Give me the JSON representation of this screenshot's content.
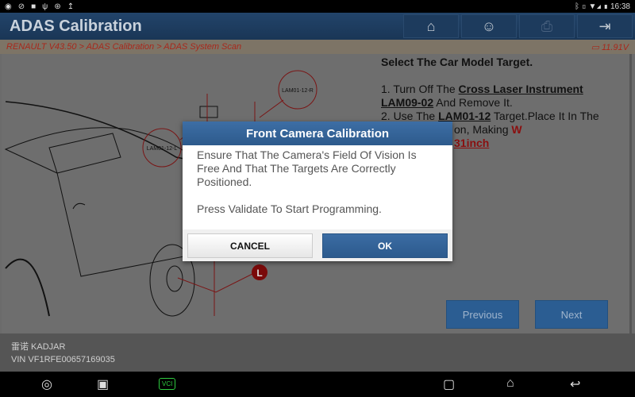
{
  "status_bar": {
    "time": "16:38",
    "left_icons": [
      "whatsapp-icon",
      "compass-icon",
      "image-icon",
      "usb-icon",
      "settings-icon",
      "upload-icon"
    ],
    "right_icons": [
      "bluetooth-icon",
      "vibrate-icon",
      "wifi-icon",
      "signal-icon",
      "battery-icon"
    ]
  },
  "header": {
    "title": "ADAS Calibration",
    "buttons": [
      {
        "name": "home",
        "icon": "⌂"
      },
      {
        "name": "support",
        "icon": "☺"
      },
      {
        "name": "print",
        "icon": "⎙"
      },
      {
        "name": "exit",
        "icon": "⇥"
      }
    ]
  },
  "breadcrumb": {
    "path": "RENAULT V43.50 > ADAS Calibration > ADAS System Scan",
    "voltage": "11.91V",
    "battery_icon": "▭"
  },
  "drawing": {
    "label_right": "LAM01-12-R",
    "label_left": "LAM01-12-L",
    "marker": "L"
  },
  "instructions": {
    "heading": "Select The Car Model Target.",
    "l1a": "1. Turn Off The ",
    "l1b": "Cross Laser Instrument",
    "l1c": "LAM09-02",
    "l1d": " And Remove It.",
    "l2a": "2. Use The ",
    "l2b": "LAM01-12",
    "l2c": " Target.Place It In The",
    "l3a": "on, Making ",
    "l3b": "W",
    "l4": "31inch"
  },
  "buttons": {
    "previous": "Previous",
    "next": "Next"
  },
  "vehicle": {
    "model": "雷诺 KADJAR",
    "vin": "VIN VF1RFE00657169035"
  },
  "dialog": {
    "title": "Front Camera Calibration",
    "message1": "Ensure That The Camera's Field Of Vision Is Free And That The Targets Are Correctly Positioned.",
    "message2": "Press Validate To Start Programming.",
    "cancel": "CANCEL",
    "ok": "OK"
  },
  "navbar": {
    "browser": "◎",
    "gallery": "▣",
    "vci": "VCI",
    "recents": "▢",
    "home": "⌂",
    "back": "↩"
  },
  "colors": {
    "header": "#1a3656",
    "accent": "#2d5a8c",
    "breadcrumb_text": "#a8281c",
    "vci": "#2ecc40"
  }
}
